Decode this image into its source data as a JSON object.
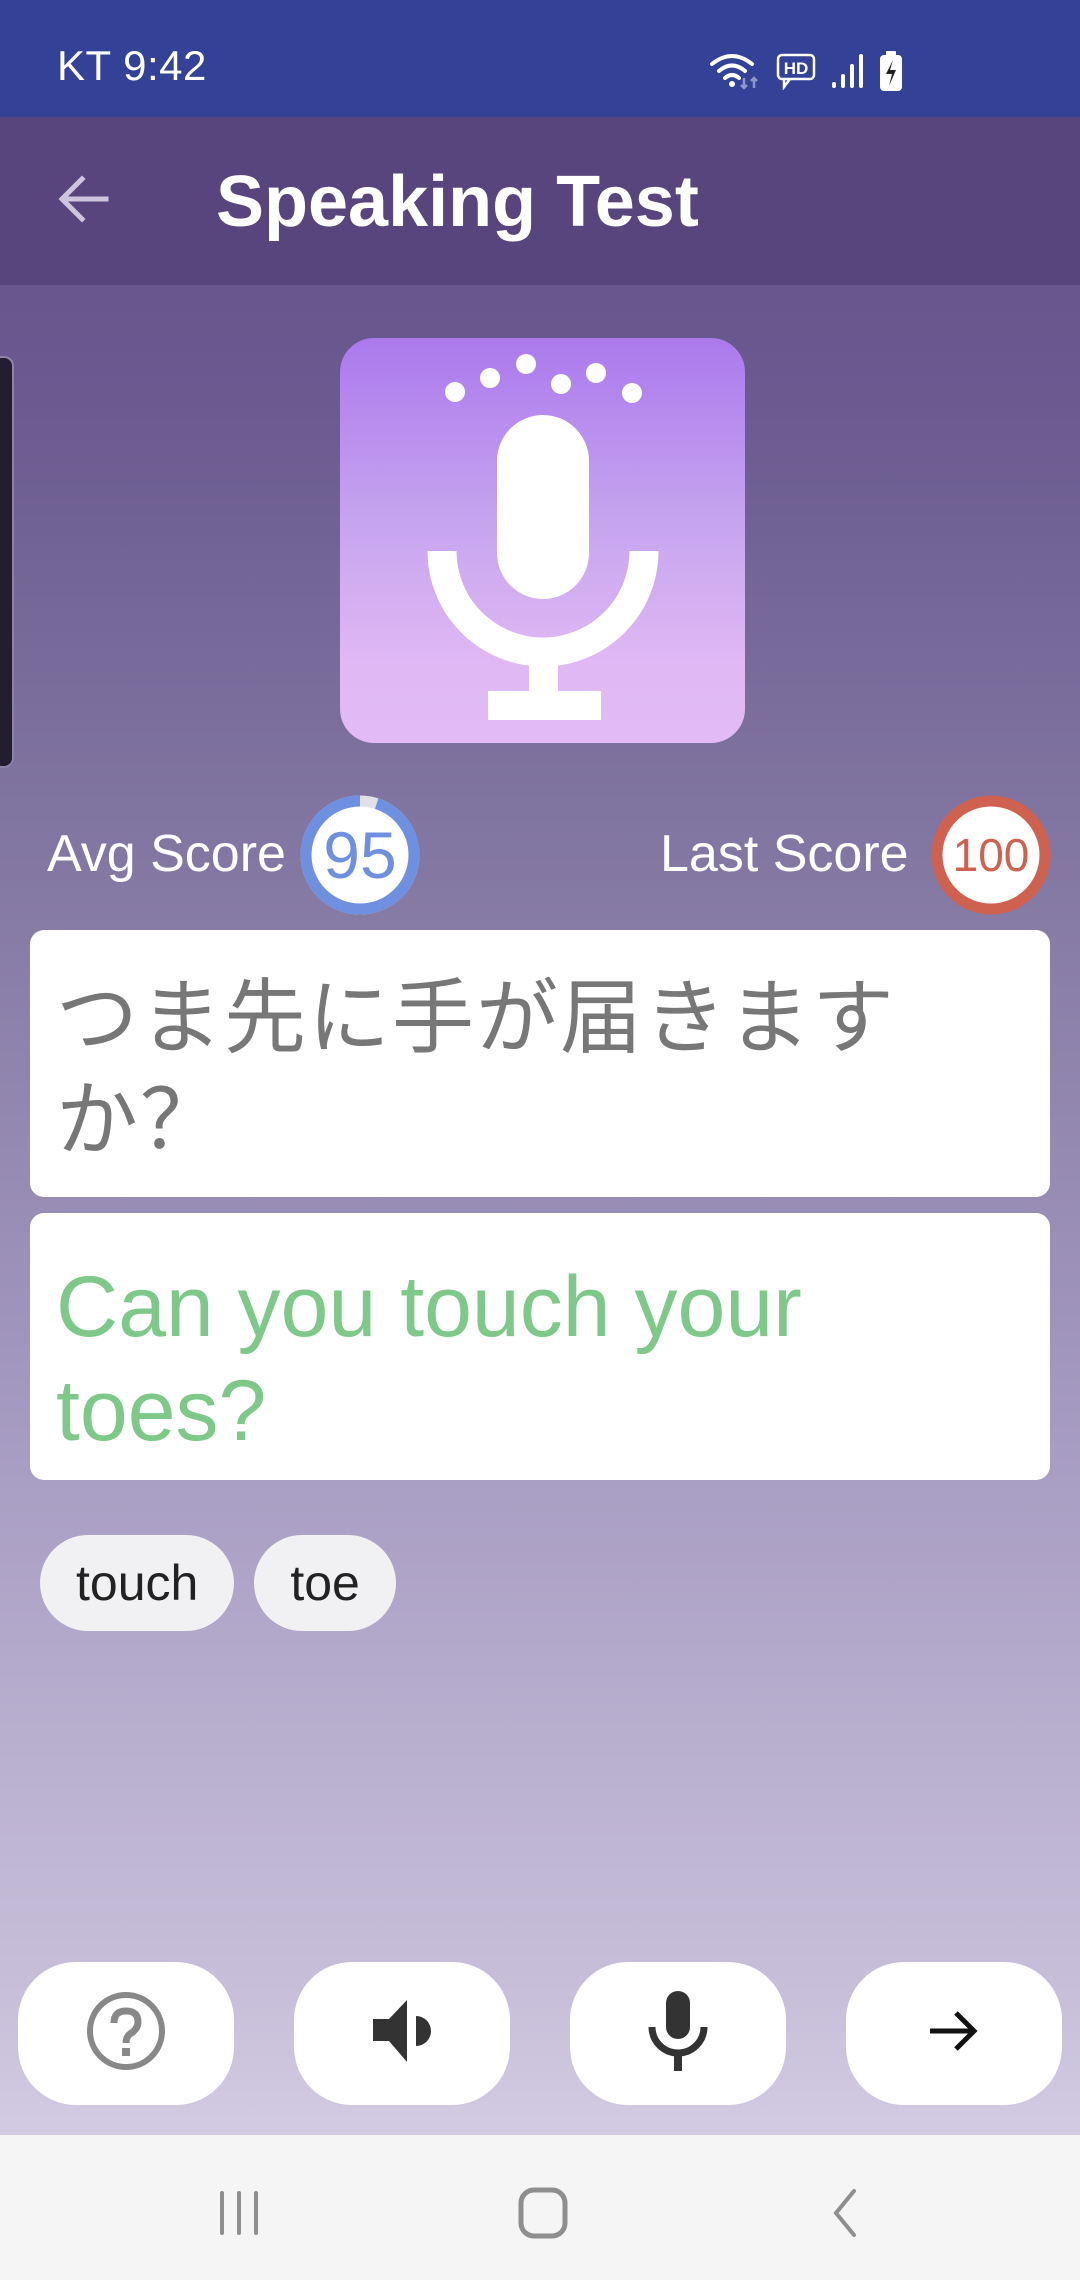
{
  "status_bar": {
    "time": "KT 9:42",
    "icons": [
      "wifi-icon",
      "hd-voice-icon",
      "signal-icon",
      "battery-charging-icon"
    ]
  },
  "app_bar": {
    "back_icon": "arrow-left-icon",
    "title": "Speaking Test"
  },
  "hero": {
    "icon": "microphone-with-dots-icon",
    "gradient_top": "#ab79ed",
    "gradient_bottom": "#e2bbf6"
  },
  "scores": {
    "avg": {
      "label": "Avg Score",
      "value": "95",
      "progress_percent": 95,
      "color": "#6f8fe0"
    },
    "last": {
      "label": "Last Score",
      "value": "100",
      "progress_percent": 100,
      "color": "#cf6150"
    }
  },
  "sentence": {
    "japanese": "つま先に手が届きますか？",
    "english": "Can you touch your toes?",
    "english_color": "#7ec98a"
  },
  "keywords": [
    "touch",
    "toe"
  ],
  "actions": [
    {
      "name": "help",
      "icon": "help-circle-icon"
    },
    {
      "name": "play-audio",
      "icon": "speaker-icon"
    },
    {
      "name": "record",
      "icon": "microphone-icon"
    },
    {
      "name": "next",
      "icon": "arrow-right-icon"
    }
  ],
  "nav_bar": {
    "buttons": [
      "recent-apps-icon",
      "home-icon",
      "back-icon"
    ]
  }
}
